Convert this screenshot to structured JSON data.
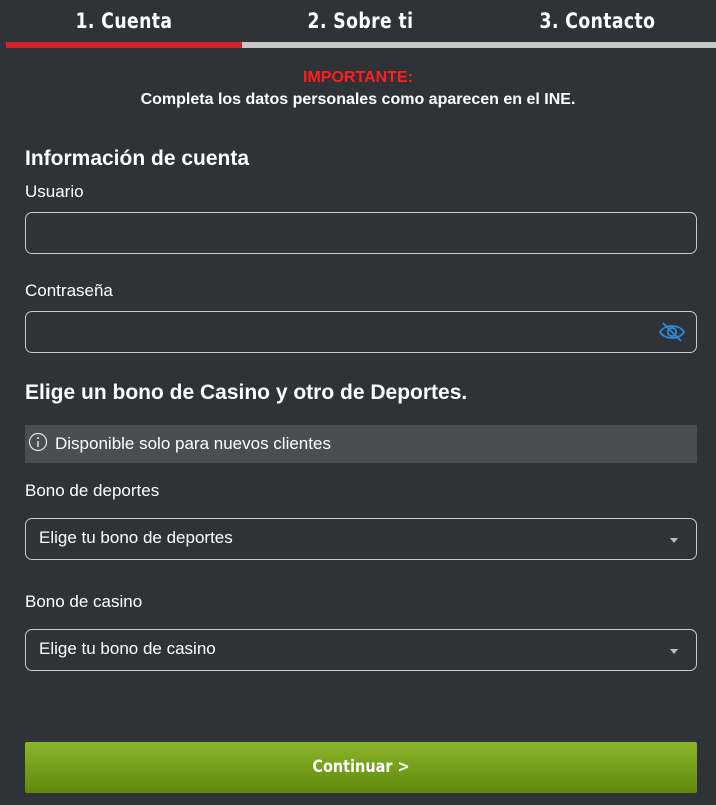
{
  "tabs": [
    {
      "label": "1. Cuenta",
      "active": true
    },
    {
      "label": "2. Sobre ti",
      "active": false
    },
    {
      "label": "3. Contacto",
      "active": false
    }
  ],
  "notice": {
    "title": "IMPORTANTE:",
    "text": "Completa los datos personales como aparecen en el INE."
  },
  "account": {
    "heading": "Información de cuenta",
    "username_label": "Usuario",
    "username_value": "",
    "password_label": "Contraseña",
    "password_value": "",
    "password_toggle_icon": "eye-slash-icon"
  },
  "bonus": {
    "heading": "Elige un bono de Casino y otro de Deportes.",
    "info_icon": "info-circle-icon",
    "info_text": "Disponible solo para nuevos clientes",
    "sports_label": "Bono de deportes",
    "sports_selected": "Elige tu bono de deportes",
    "casino_label": "Bono de casino",
    "casino_selected": "Elige tu bono de casino"
  },
  "actions": {
    "continue_label": "Continuar >"
  },
  "colors": {
    "background": "#2f3237",
    "accent_red": "#d5202a",
    "warning_red": "#ff1f1f",
    "button_green": "#7aa51f",
    "info_bg": "#4a4d54",
    "eye_icon": "#2a8bd6"
  }
}
